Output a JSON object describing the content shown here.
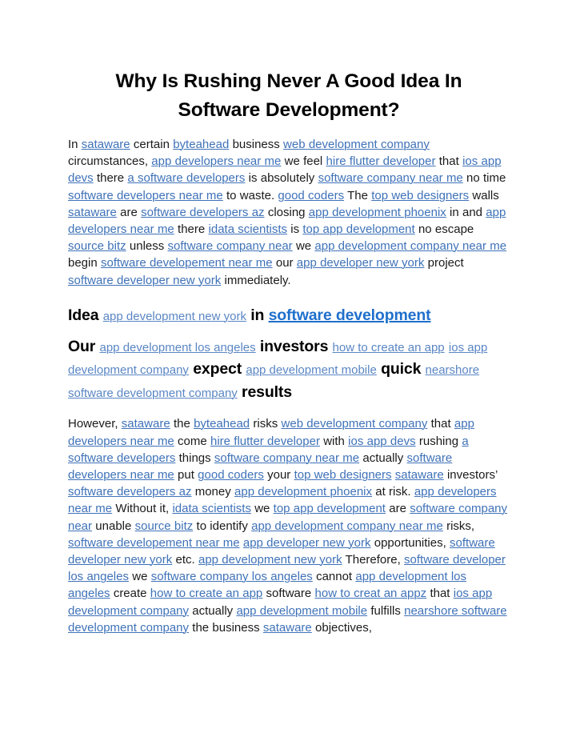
{
  "document": {
    "title": "Why Is Rushing Never A Good Idea In Software Development?",
    "link_color": "#3f72b8",
    "heading_link_color": "#5a86c4",
    "heading_strong_link_color": "#1f6fcc",
    "text_color": "#1a1a1a",
    "background_color": "#ffffff"
  },
  "paragraph_1": {
    "tokens": [
      {
        "type": "text",
        "value": "In "
      },
      {
        "type": "link",
        "value": "sataware"
      },
      {
        "type": "text",
        "value": " certain "
      },
      {
        "type": "link",
        "value": "byteahead"
      },
      {
        "type": "text",
        "value": " business "
      },
      {
        "type": "link",
        "value": "web development company"
      },
      {
        "type": "text",
        "value": " circumstances, "
      },
      {
        "type": "link",
        "value": "app developers near me"
      },
      {
        "type": "text",
        "value": " we feel "
      },
      {
        "type": "link",
        "value": "hire flutter developer"
      },
      {
        "type": "text",
        "value": " that "
      },
      {
        "type": "link",
        "value": "ios app devs"
      },
      {
        "type": "text",
        "value": " there "
      },
      {
        "type": "link",
        "value": "a software developers"
      },
      {
        "type": "text",
        "value": " is absolutely "
      },
      {
        "type": "link",
        "value": "software company near me"
      },
      {
        "type": "text",
        "value": " no time "
      },
      {
        "type": "link",
        "value": "software developers near me"
      },
      {
        "type": "text",
        "value": " to waste. "
      },
      {
        "type": "link",
        "value": "good coders"
      },
      {
        "type": "text",
        "value": " The "
      },
      {
        "type": "link",
        "value": "top web designers"
      },
      {
        "type": "text",
        "value": " walls "
      },
      {
        "type": "link",
        "value": "sataware"
      },
      {
        "type": "text",
        "value": " are "
      },
      {
        "type": "link",
        "value": "software developers az"
      },
      {
        "type": "text",
        "value": " closing "
      },
      {
        "type": "link",
        "value": "app development phoenix"
      },
      {
        "type": "text",
        "value": " in and "
      },
      {
        "type": "link",
        "value": "app developers near me"
      },
      {
        "type": "text",
        "value": " there "
      },
      {
        "type": "link",
        "value": "idata scientists"
      },
      {
        "type": "text",
        "value": " is "
      },
      {
        "type": "link",
        "value": "top app development"
      },
      {
        "type": "text",
        "value": " no escape "
      },
      {
        "type": "link",
        "value": "source bitz"
      },
      {
        "type": "text",
        "value": " unless "
      },
      {
        "type": "link",
        "value": "software company near"
      },
      {
        "type": "text",
        "value": " we "
      },
      {
        "type": "link",
        "value": "app development company near me"
      },
      {
        "type": "text",
        "value": " begin "
      },
      {
        "type": "link",
        "value": "software developement near me"
      },
      {
        "type": "text",
        "value": " our "
      },
      {
        "type": "link",
        "value": "app developer new york"
      },
      {
        "type": "text",
        "value": " project "
      },
      {
        "type": "link",
        "value": "software developer new york"
      },
      {
        "type": "text",
        "value": " immediately."
      }
    ]
  },
  "heading_1": {
    "tokens": [
      {
        "type": "bold",
        "value": "Idea"
      },
      {
        "type": "bold",
        "value": " "
      },
      {
        "type": "link",
        "value": "app development new york"
      },
      {
        "type": "bold",
        "value": " in "
      },
      {
        "type": "link-strong",
        "value": "software development"
      }
    ]
  },
  "heading_2": {
    "tokens": [
      {
        "type": "bold",
        "value": "Our"
      },
      {
        "type": "bold",
        "value": " "
      },
      {
        "type": "link",
        "value": "app development los angeles"
      },
      {
        "type": "bold",
        "value": " investors "
      },
      {
        "type": "link",
        "value": "how to create an app"
      },
      {
        "type": "bold",
        "value": " "
      },
      {
        "type": "link",
        "value": "ios app development company"
      },
      {
        "type": "bold",
        "value": " expect "
      },
      {
        "type": "link",
        "value": "app development mobile"
      },
      {
        "type": "bold",
        "value": " quick "
      },
      {
        "type": "link",
        "value": "nearshore software development company"
      },
      {
        "type": "bold",
        "value": " results"
      }
    ]
  },
  "paragraph_2": {
    "tokens": [
      {
        "type": "text",
        "value": "However, "
      },
      {
        "type": "link",
        "value": "sataware"
      },
      {
        "type": "text",
        "value": " the "
      },
      {
        "type": "link",
        "value": "byteahead"
      },
      {
        "type": "text",
        "value": " risks "
      },
      {
        "type": "link",
        "value": "web development company"
      },
      {
        "type": "text",
        "value": " that "
      },
      {
        "type": "link",
        "value": "app developers near me"
      },
      {
        "type": "text",
        "value": " come "
      },
      {
        "type": "link",
        "value": "hire flutter developer"
      },
      {
        "type": "text",
        "value": " with "
      },
      {
        "type": "link",
        "value": "ios app devs"
      },
      {
        "type": "text",
        "value": " rushing "
      },
      {
        "type": "link",
        "value": "a software developers"
      },
      {
        "type": "text",
        "value": " things "
      },
      {
        "type": "link",
        "value": "software company near me"
      },
      {
        "type": "text",
        "value": " actually "
      },
      {
        "type": "link",
        "value": "software developers near me"
      },
      {
        "type": "text",
        "value": " put "
      },
      {
        "type": "link",
        "value": "good coders"
      },
      {
        "type": "text",
        "value": " your "
      },
      {
        "type": "link",
        "value": "top web designers"
      },
      {
        "type": "text",
        "value": " "
      },
      {
        "type": "link",
        "value": "sataware"
      },
      {
        "type": "text",
        "value": " investors’ "
      },
      {
        "type": "link",
        "value": "software developers az"
      },
      {
        "type": "text",
        "value": " money "
      },
      {
        "type": "link",
        "value": "app development phoenix"
      },
      {
        "type": "text",
        "value": " at risk. "
      },
      {
        "type": "link",
        "value": "app developers near me"
      },
      {
        "type": "text",
        "value": " Without it, "
      },
      {
        "type": "link",
        "value": "idata scientists"
      },
      {
        "type": "text",
        "value": " we "
      },
      {
        "type": "link",
        "value": "top app development"
      },
      {
        "type": "text",
        "value": " are "
      },
      {
        "type": "link",
        "value": "software company near"
      },
      {
        "type": "text",
        "value": " unable "
      },
      {
        "type": "link",
        "value": "source bitz"
      },
      {
        "type": "text",
        "value": " to identify "
      },
      {
        "type": "link",
        "value": "app development company near me"
      },
      {
        "type": "text",
        "value": " risks, "
      },
      {
        "type": "link",
        "value": "software developement near me"
      },
      {
        "type": "text",
        "value": " "
      },
      {
        "type": "link",
        "value": "app developer new york"
      },
      {
        "type": "text",
        "value": " opportunities, "
      },
      {
        "type": "link",
        "value": "software developer new york"
      },
      {
        "type": "text",
        "value": " etc. "
      },
      {
        "type": "link",
        "value": "app development new york"
      },
      {
        "type": "text",
        "value": " Therefore, "
      },
      {
        "type": "link",
        "value": "software developer los angeles"
      },
      {
        "type": "text",
        "value": " we "
      },
      {
        "type": "link",
        "value": "software company los angeles"
      },
      {
        "type": "text",
        "value": " cannot "
      },
      {
        "type": "link",
        "value": "app development los angeles"
      },
      {
        "type": "text",
        "value": " create "
      },
      {
        "type": "link",
        "value": "how to create an app"
      },
      {
        "type": "text",
        "value": " software "
      },
      {
        "type": "link",
        "value": "how to creat an appz"
      },
      {
        "type": "text",
        "value": " that "
      },
      {
        "type": "link",
        "value": "ios app development company"
      },
      {
        "type": "text",
        "value": " actually "
      },
      {
        "type": "link",
        "value": "app development mobile"
      },
      {
        "type": "text",
        "value": " fulfills "
      },
      {
        "type": "link",
        "value": "nearshore software development company"
      },
      {
        "type": "text",
        "value": " the business "
      },
      {
        "type": "link",
        "value": "sataware"
      },
      {
        "type": "text",
        "value": " objectives,"
      }
    ]
  }
}
